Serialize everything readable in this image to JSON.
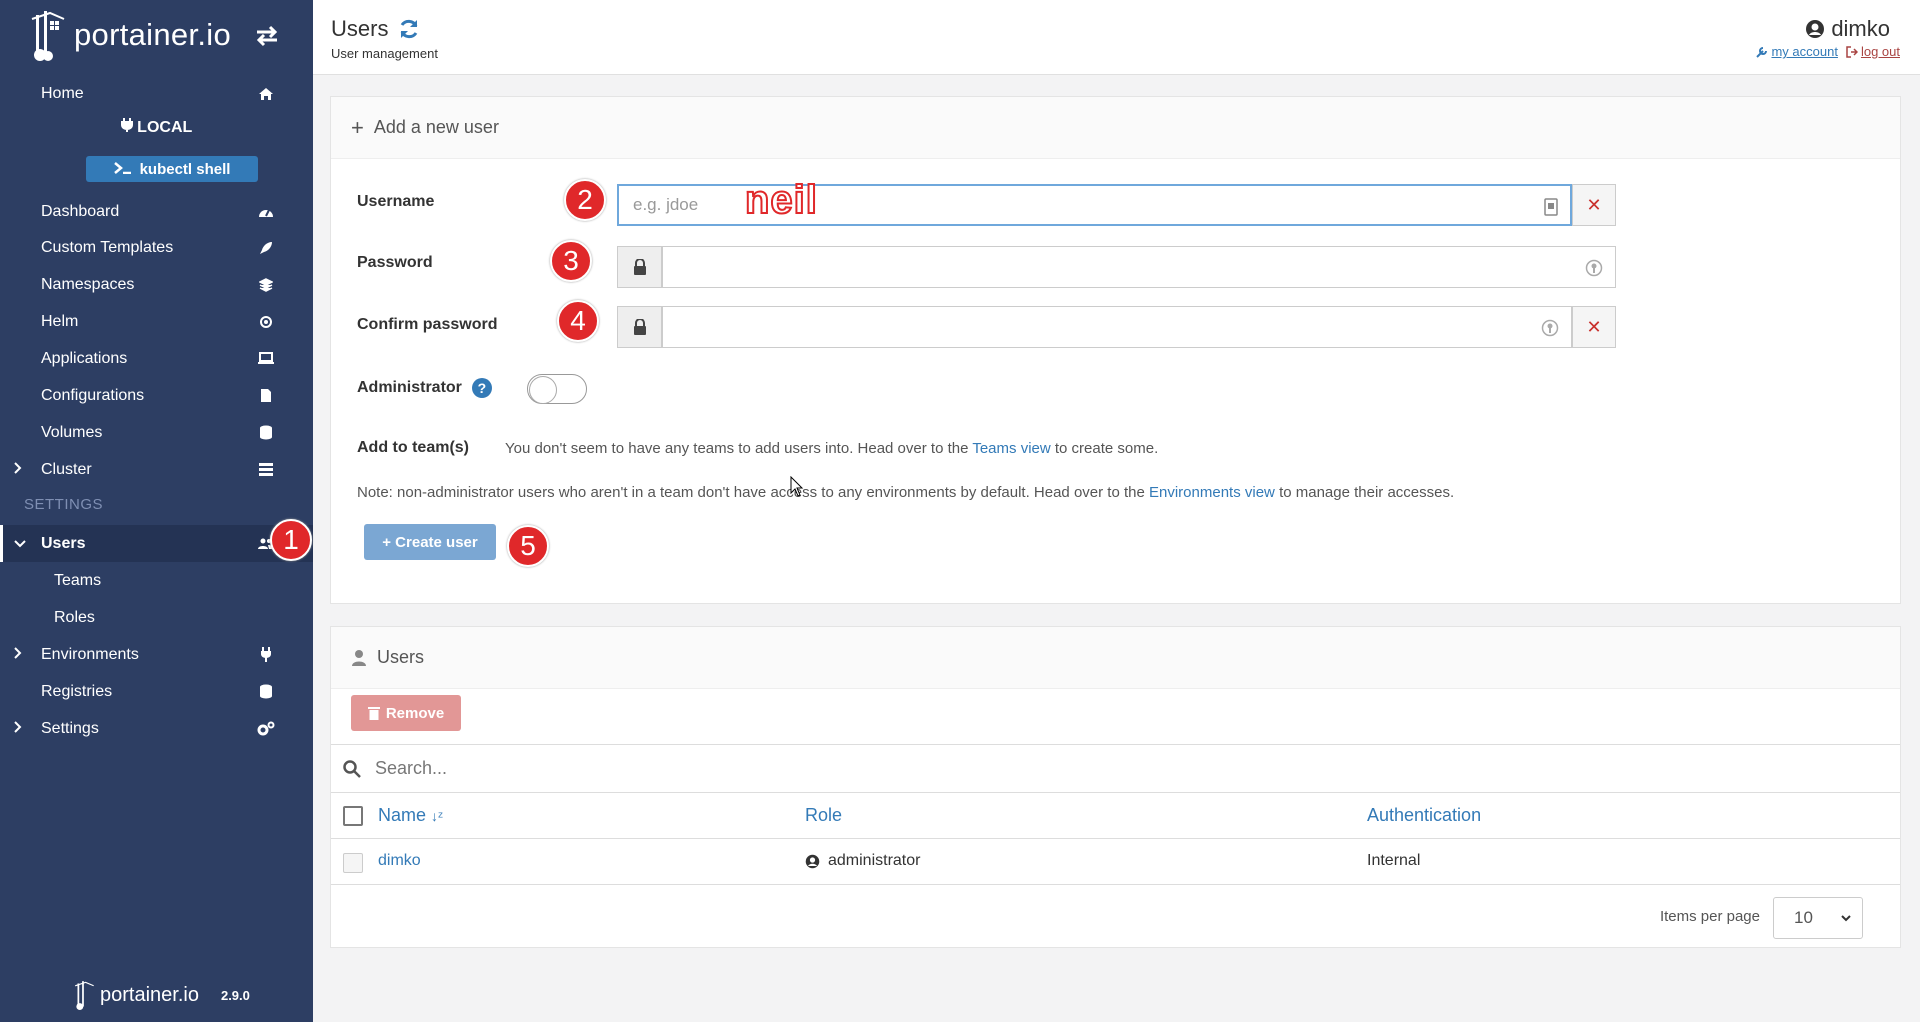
{
  "sidebar": {
    "brand": "portainer.io",
    "home": "Home",
    "env_name": "LOCAL",
    "kubectl": "kubectl shell",
    "items": {
      "dashboard": "Dashboard",
      "custom_templates": "Custom Templates",
      "namespaces": "Namespaces",
      "helm": "Helm",
      "applications": "Applications",
      "configurations": "Configurations",
      "volumes": "Volumes",
      "cluster": "Cluster"
    },
    "settings_heading": "SETTINGS",
    "users": "Users",
    "teams": "Teams",
    "roles": "Roles",
    "environments": "Environments",
    "registries": "Registries",
    "settings": "Settings",
    "footer_brand": "portainer.io",
    "version": "2.9.0"
  },
  "header": {
    "title": "Users",
    "subtitle": "User management",
    "username": "dimko",
    "my_account": "my account",
    "log_out": "log out"
  },
  "add_user": {
    "panel_title": "Add a new user",
    "username_label": "Username",
    "username_placeholder": "e.g. jdoe",
    "username_annotation": "neil",
    "password_label": "Password",
    "confirm_label": "Confirm password",
    "admin_label": "Administrator",
    "admin_enabled": false,
    "teams_label": "Add to team(s)",
    "teams_text_pre": "You don't seem to have any teams to add users into. Head over to the",
    "teams_link": "Teams view",
    "teams_text_post": "to create some.",
    "note_pre": "Note: non-administrator users who aren't in a team don't have access to any environments by default. Head over to the",
    "note_link": "Environments view",
    "note_post": "to manage their accesses.",
    "create_button": "+ Create user"
  },
  "annotations": {
    "b1": "1",
    "b2": "2",
    "b3": "3",
    "b4": "4",
    "b5": "5"
  },
  "users_table": {
    "panel_title": "Users",
    "remove_button": "Remove",
    "search_placeholder": "Search...",
    "columns": {
      "name": "Name",
      "role": "Role",
      "auth": "Authentication"
    },
    "rows": [
      {
        "name": "dimko",
        "role": "administrator",
        "auth": "Internal"
      }
    ],
    "items_per_page_label": "Items per page",
    "items_per_page": "10"
  }
}
